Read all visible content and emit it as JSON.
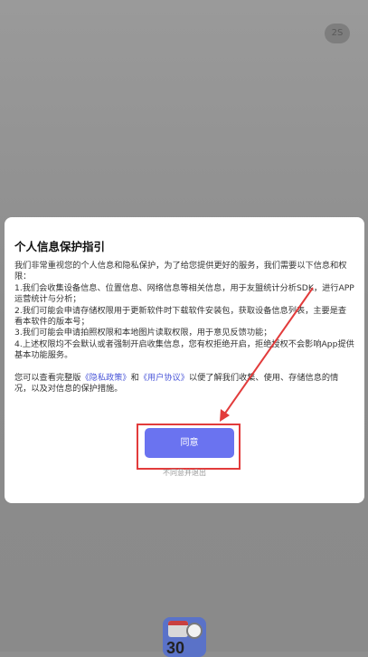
{
  "splash": {
    "skip_countdown": "2S"
  },
  "dialog": {
    "title": "个人信息保护指引",
    "intro": "我们非常重视您的个人信息和隐私保护，为了给您提供更好的服务，我们需要以下信息和权限：",
    "items": [
      "1.我们会收集设备信息、位置信息、网络信息等相关信息，用于友盟统计分析SDK，进行APP运营统计与分析；",
      "2.我们可能会申请存储权限用于更新软件时下载软件安装包，获取设备信息列表，主要是查看本软件的版本号；",
      "3.我们可能会申请拍照权限和本地图片读取权限，用于意见反馈功能；",
      "4.上述权限均不会默认或者强制开启收集信息，您有权拒绝开启，拒绝授权不会影响App提供基本功能服务。"
    ],
    "footer_prefix": "您可以查看完整版",
    "privacy_link": "《隐私政策》",
    "footer_and": "和",
    "agreement_link": "《用户协议》",
    "footer_suffix": "以便了解我们收集、使用、存储信息的情况，以及对信息的保护措施。",
    "agree_label": "同意",
    "decline_label": "不同意并退出"
  },
  "dock": {
    "calendar_day": "30"
  },
  "colors": {
    "accent": "#6a73f0",
    "link": "#4a56d8",
    "annotation": "#e23b3b"
  }
}
